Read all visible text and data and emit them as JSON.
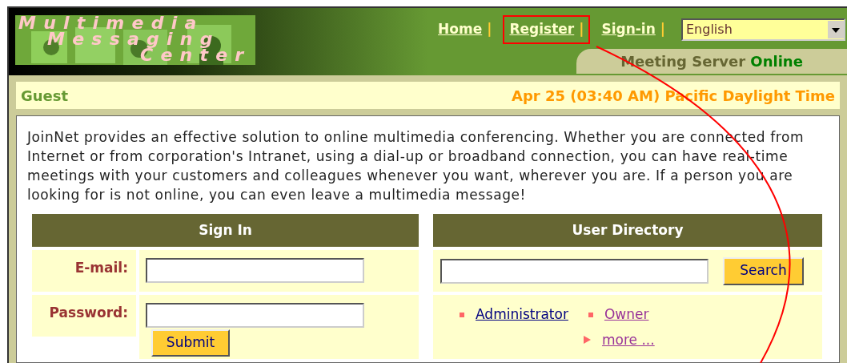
{
  "logo": {
    "lines": [
      "Multimedia",
      "Messaging",
      "Center"
    ]
  },
  "nav": {
    "links": [
      {
        "label": "Home",
        "highlighted": false
      },
      {
        "label": "Register",
        "highlighted": true
      },
      {
        "label": "Sign-in",
        "highlighted": false
      }
    ],
    "separator": "|"
  },
  "language_select": {
    "value": "English"
  },
  "server_status": {
    "label": "Meeting Server",
    "status": "Online"
  },
  "info_bar": {
    "user": "Guest",
    "datetime": "Apr 25 (03:40 AM) Pacific Daylight Time"
  },
  "intro": "JoinNet provides an effective solution to online multimedia conferencing. Whether you are connected from Internet or from corporation's Intranet, using a dial-up or broadband connection, you can have real-time meetings with your customers and colleagues whenever you want, wherever you are. If a person you are looking for is not online, you can even leave a multimedia message!",
  "sign_in": {
    "title": "Sign In",
    "fields": [
      {
        "label": "E-mail:"
      },
      {
        "label": "Password:"
      }
    ],
    "submit": "Submit"
  },
  "user_directory": {
    "title": "User Directory",
    "search_button": "Search",
    "users": [
      {
        "label": "Administrator",
        "visited": false
      },
      {
        "label": "Owner",
        "visited": true
      }
    ],
    "more": {
      "label": "more ...",
      "visited": true
    }
  }
}
